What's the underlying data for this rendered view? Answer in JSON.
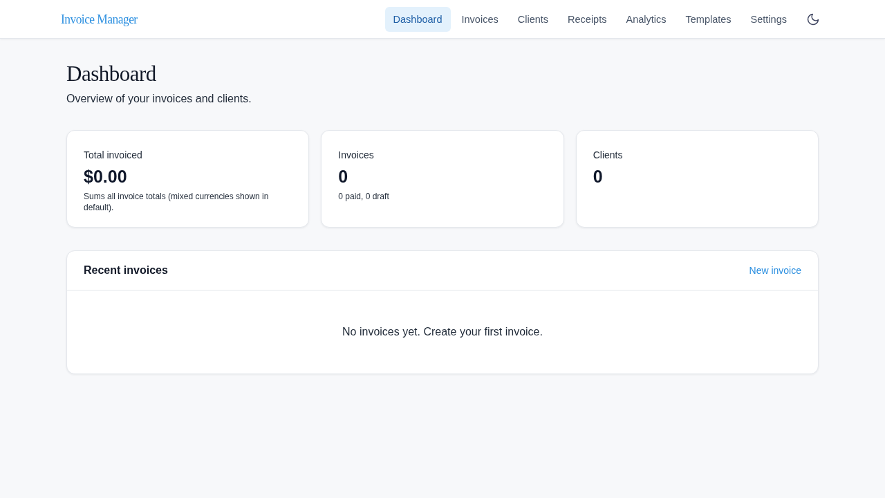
{
  "header": {
    "logo": "Invoice Manager",
    "nav": [
      {
        "label": "Dashboard",
        "selected": true
      },
      {
        "label": "Invoices",
        "selected": false
      },
      {
        "label": "Clients",
        "selected": false
      },
      {
        "label": "Receipts",
        "selected": false
      },
      {
        "label": "Analytics",
        "selected": false
      },
      {
        "label": "Templates",
        "selected": false
      },
      {
        "label": "Settings",
        "selected": false
      }
    ]
  },
  "page": {
    "title": "Dashboard",
    "subtitle": "Overview of your invoices and clients."
  },
  "stats": [
    {
      "label": "Total invoiced",
      "value": "$0.00",
      "note": "Sums all invoice totals (mixed currencies shown in default)."
    },
    {
      "label": "Invoices",
      "value": "0",
      "note": "0 paid, 0 draft"
    },
    {
      "label": "Clients",
      "value": "0"
    }
  ],
  "recent_invoices": {
    "title": "Recent invoices",
    "action": "New invoice",
    "empty_message": "No invoices yet. Create your first invoice."
  }
}
